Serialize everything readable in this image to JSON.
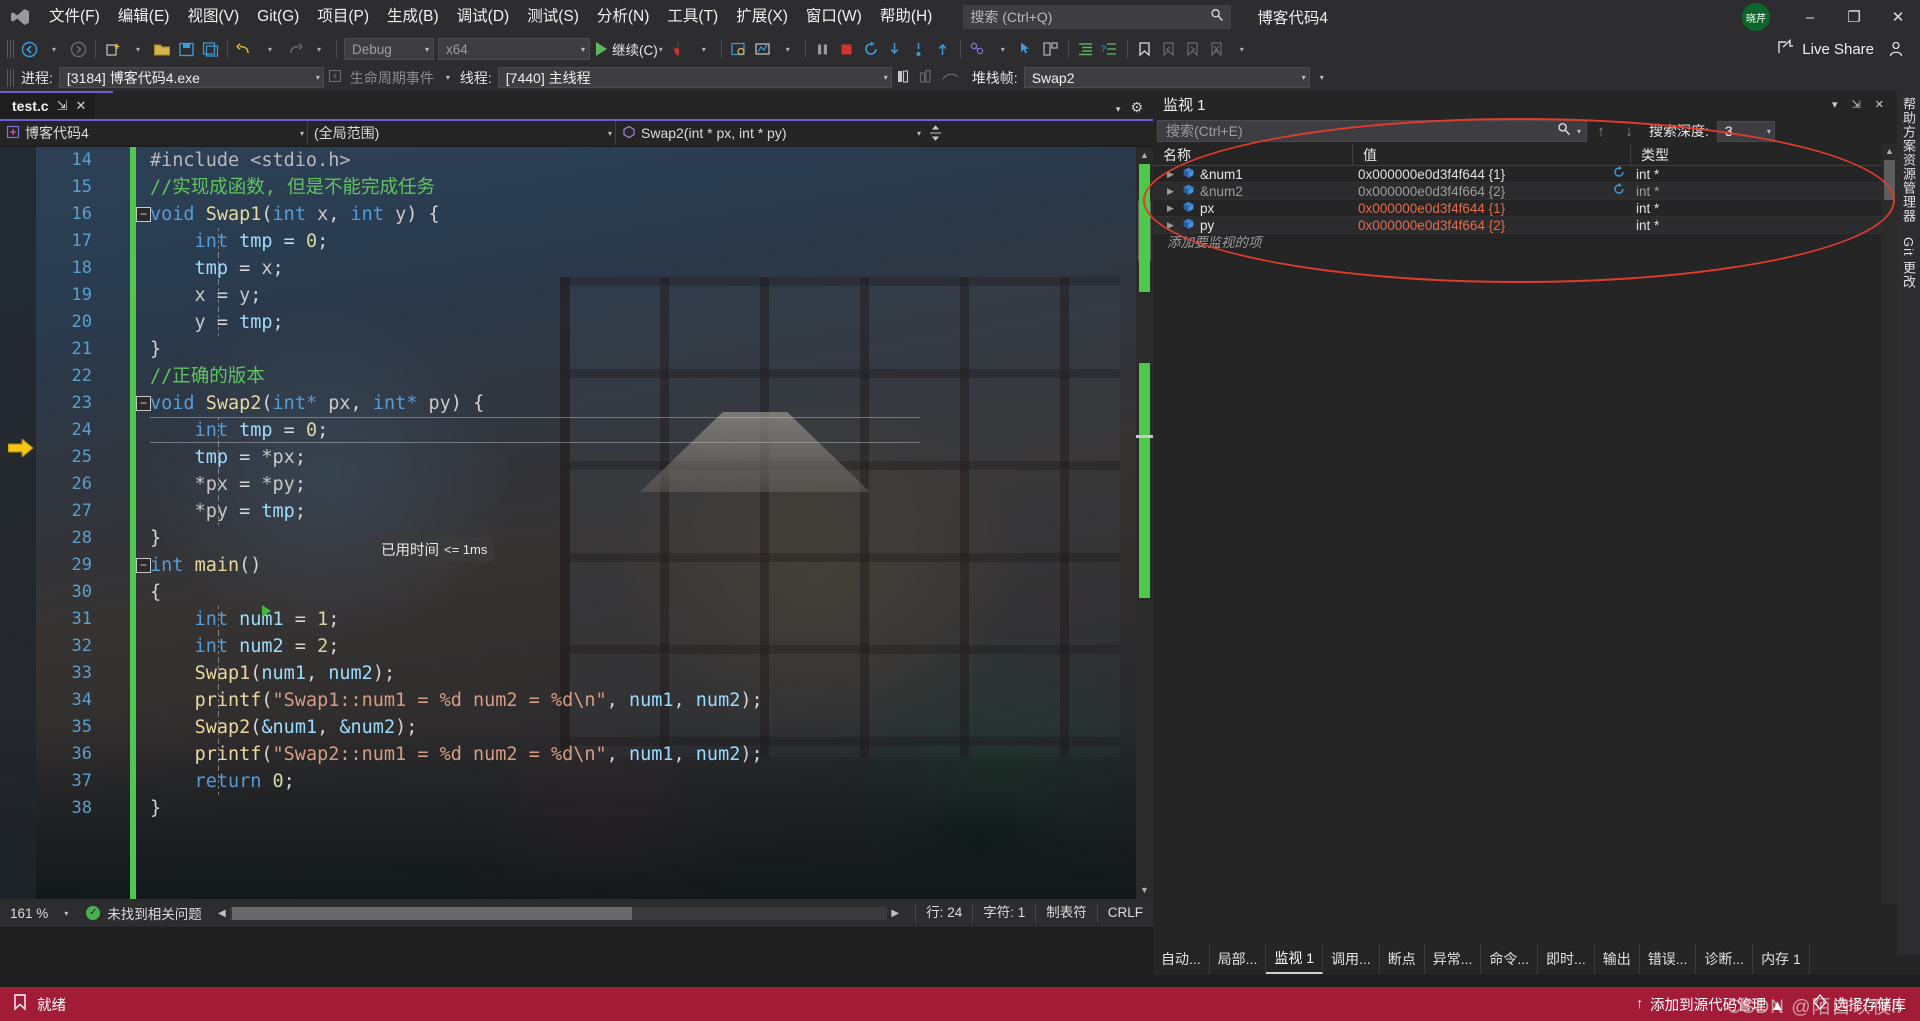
{
  "app": {
    "solution_title": "博客代码4",
    "logo_icon": "visual-studio-logo"
  },
  "menu": {
    "items": [
      {
        "label": "文件(F)"
      },
      {
        "label": "编辑(E)"
      },
      {
        "label": "视图(V)"
      },
      {
        "label": "Git(G)"
      },
      {
        "label": "项目(P)"
      },
      {
        "label": "生成(B)"
      },
      {
        "label": "调试(D)"
      },
      {
        "label": "测试(S)"
      },
      {
        "label": "分析(N)"
      },
      {
        "label": "工具(T)"
      },
      {
        "label": "扩展(X)"
      },
      {
        "label": "窗口(W)"
      },
      {
        "label": "帮助(H)"
      }
    ]
  },
  "quick_search": {
    "placeholder": "搜索 (Ctrl+Q)",
    "icon": "search-icon"
  },
  "account": {
    "initials": "晓芹"
  },
  "window_controls": {
    "minimize": "–",
    "restore": "❐",
    "close": "✕"
  },
  "toolbar": {
    "config": "Debug",
    "platform": "x64",
    "run_label": "继续(C)",
    "live_share": "Live Share"
  },
  "debug_bar": {
    "process_label": "进程:",
    "process_value": "[3184] 博客代码4.exe",
    "lifecycle_label": "生命周期事件",
    "thread_label": "线程:",
    "thread_value": "[7440] 主线程",
    "stack_label": "堆栈帧:",
    "stack_value": "Swap2"
  },
  "editor": {
    "tab_name": "test.c",
    "tab_pin": "⇲",
    "tab_close": "✕",
    "nav_project": "博客代码4",
    "nav_scope": "(全局范围)",
    "nav_member": "Swap2(int * px, int * py)",
    "datatip": {
      "label": "已用时间",
      "value": "<= 1ms"
    },
    "lines": [
      {
        "n": "14",
        "segs": [
          {
            "t": "#include <stdio.h>",
            "c": "pp"
          }
        ],
        "indent": 0
      },
      {
        "n": "15",
        "segs": [
          {
            "t": "//实现成函数, 但是不能完成任务",
            "c": "cmt"
          }
        ],
        "indent": 1
      },
      {
        "n": "16",
        "fold": "−",
        "segs": [
          {
            "t": "void ",
            "c": "kw"
          },
          {
            "t": "Swap1",
            "c": "fn"
          },
          {
            "t": "(",
            "c": "pun"
          },
          {
            "t": "int",
            "c": "kw"
          },
          {
            "t": " x",
            "c": "id"
          },
          {
            "t": ", ",
            "c": "pun"
          },
          {
            "t": "int",
            "c": "kw"
          },
          {
            "t": " y",
            "c": "id"
          },
          {
            "t": ") {",
            "c": "pun"
          }
        ],
        "indent": 1
      },
      {
        "n": "17",
        "segs": [
          {
            "t": "    int",
            "c": "kw"
          },
          {
            "t": " tmp",
            "c": "var"
          },
          {
            "t": " = ",
            "c": "pun"
          },
          {
            "t": "0",
            "c": "num"
          },
          {
            "t": ";",
            "c": "pun"
          }
        ],
        "indent": 1,
        "guide": true
      },
      {
        "n": "18",
        "segs": [
          {
            "t": "    tmp",
            "c": "var"
          },
          {
            "t": " = ",
            "c": "pun"
          },
          {
            "t": "x",
            "c": "id"
          },
          {
            "t": ";",
            "c": "pun"
          }
        ],
        "indent": 1,
        "guide": true
      },
      {
        "n": "19",
        "segs": [
          {
            "t": "    x",
            "c": "id"
          },
          {
            "t": " = ",
            "c": "pun"
          },
          {
            "t": "y",
            "c": "id"
          },
          {
            "t": ";",
            "c": "pun"
          }
        ],
        "indent": 1,
        "guide": true
      },
      {
        "n": "20",
        "segs": [
          {
            "t": "    y",
            "c": "id"
          },
          {
            "t": " = ",
            "c": "pun"
          },
          {
            "t": "tmp",
            "c": "var"
          },
          {
            "t": ";",
            "c": "pun"
          }
        ],
        "indent": 1,
        "guide": true
      },
      {
        "n": "21",
        "segs": [
          {
            "t": "}",
            "c": "pun"
          }
        ],
        "indent": 1
      },
      {
        "n": "22",
        "segs": [
          {
            "t": "//正确的版本",
            "c": "cmt"
          }
        ],
        "indent": 1
      },
      {
        "n": "23",
        "fold": "−",
        "segs": [
          {
            "t": "void ",
            "c": "kw"
          },
          {
            "t": "Swap2",
            "c": "fn"
          },
          {
            "t": "(",
            "c": "pun"
          },
          {
            "t": "int*",
            "c": "kw"
          },
          {
            "t": " px",
            "c": "id"
          },
          {
            "t": ", ",
            "c": "pun"
          },
          {
            "t": "int*",
            "c": "kw"
          },
          {
            "t": " py",
            "c": "id"
          },
          {
            "t": ") {",
            "c": "pun"
          }
        ],
        "indent": 1
      },
      {
        "n": "24",
        "segs": [
          {
            "t": "    int",
            "c": "kw"
          },
          {
            "t": " tmp",
            "c": "var"
          },
          {
            "t": " = ",
            "c": "pun"
          },
          {
            "t": "0",
            "c": "num"
          },
          {
            "t": ";",
            "c": "pun"
          }
        ],
        "indent": 1,
        "guide": true,
        "current": true
      },
      {
        "n": "25",
        "segs": [
          {
            "t": "    tmp",
            "c": "var"
          },
          {
            "t": " = ",
            "c": "pun"
          },
          {
            "t": "*px",
            "c": "id"
          },
          {
            "t": ";",
            "c": "pun"
          }
        ],
        "indent": 1,
        "guide": true
      },
      {
        "n": "26",
        "segs": [
          {
            "t": "    *px",
            "c": "id"
          },
          {
            "t": " = ",
            "c": "pun"
          },
          {
            "t": "*py",
            "c": "id"
          },
          {
            "t": ";",
            "c": "pun"
          }
        ],
        "indent": 1,
        "guide": true,
        "bp": true
      },
      {
        "n": "27",
        "segs": [
          {
            "t": "    *py",
            "c": "id"
          },
          {
            "t": " = ",
            "c": "pun"
          },
          {
            "t": "tmp",
            "c": "var"
          },
          {
            "t": ";",
            "c": "pun"
          }
        ],
        "indent": 1,
        "guide": true
      },
      {
        "n": "28",
        "segs": [
          {
            "t": "}",
            "c": "pun"
          }
        ],
        "indent": 1
      },
      {
        "n": "29",
        "fold": "−",
        "segs": [
          {
            "t": "int ",
            "c": "kw"
          },
          {
            "t": "main",
            "c": "fn"
          },
          {
            "t": "()",
            "c": "pun"
          }
        ],
        "indent": 1
      },
      {
        "n": "30",
        "segs": [
          {
            "t": "{",
            "c": "pun"
          }
        ],
        "indent": 1
      },
      {
        "n": "31",
        "segs": [
          {
            "t": "    int",
            "c": "kw"
          },
          {
            "t": " num1",
            "c": "var"
          },
          {
            "t": " = ",
            "c": "pun"
          },
          {
            "t": "1",
            "c": "num"
          },
          {
            "t": ";",
            "c": "pun"
          }
        ],
        "indent": 1,
        "guide": true
      },
      {
        "n": "32",
        "segs": [
          {
            "t": "    int",
            "c": "kw"
          },
          {
            "t": " num2",
            "c": "var"
          },
          {
            "t": " = ",
            "c": "pun"
          },
          {
            "t": "2",
            "c": "num"
          },
          {
            "t": ";",
            "c": "pun"
          }
        ],
        "indent": 1,
        "guide": true
      },
      {
        "n": "33",
        "segs": [
          {
            "t": "    ",
            "c": "pun"
          },
          {
            "t": "Swap1",
            "c": "fn"
          },
          {
            "t": "(",
            "c": "pun"
          },
          {
            "t": "num1",
            "c": "var"
          },
          {
            "t": ", ",
            "c": "pun"
          },
          {
            "t": "num2",
            "c": "var"
          },
          {
            "t": ");",
            "c": "pun"
          }
        ],
        "indent": 1,
        "guide": true
      },
      {
        "n": "34",
        "segs": [
          {
            "t": "    ",
            "c": "pun"
          },
          {
            "t": "printf",
            "c": "fn"
          },
          {
            "t": "(",
            "c": "pun"
          },
          {
            "t": "\"Swap1::num1 = %d num2 = %d\\n\"",
            "c": "str"
          },
          {
            "t": ", ",
            "c": "pun"
          },
          {
            "t": "num1",
            "c": "var"
          },
          {
            "t": ", ",
            "c": "pun"
          },
          {
            "t": "num2",
            "c": "var"
          },
          {
            "t": ");",
            "c": "pun"
          }
        ],
        "indent": 1,
        "guide": true
      },
      {
        "n": "35",
        "segs": [
          {
            "t": "    ",
            "c": "pun"
          },
          {
            "t": "Swap2",
            "c": "fn"
          },
          {
            "t": "(",
            "c": "pun"
          },
          {
            "t": "&num1",
            "c": "var"
          },
          {
            "t": ", ",
            "c": "pun"
          },
          {
            "t": "&num2",
            "c": "var"
          },
          {
            "t": ");",
            "c": "pun"
          }
        ],
        "indent": 1,
        "guide": true
      },
      {
        "n": "36",
        "segs": [
          {
            "t": "    ",
            "c": "pun"
          },
          {
            "t": "printf",
            "c": "fn"
          },
          {
            "t": "(",
            "c": "pun"
          },
          {
            "t": "\"Swap2::num1 = %d num2 = %d\\n\"",
            "c": "str"
          },
          {
            "t": ", ",
            "c": "pun"
          },
          {
            "t": "num1",
            "c": "var"
          },
          {
            "t": ", ",
            "c": "pun"
          },
          {
            "t": "num2",
            "c": "var"
          },
          {
            "t": ");",
            "c": "pun"
          }
        ],
        "indent": 1,
        "guide": true
      },
      {
        "n": "37",
        "segs": [
          {
            "t": "    return ",
            "c": "kw"
          },
          {
            "t": "0",
            "c": "num"
          },
          {
            "t": ";",
            "c": "pun"
          }
        ],
        "indent": 1,
        "guide": true
      },
      {
        "n": "38",
        "segs": [
          {
            "t": "}",
            "c": "pun"
          }
        ],
        "indent": 1
      }
    ],
    "status": {
      "zoom": "161 %",
      "issues": "未找到相关问题",
      "line": "行: 24",
      "column": "字符: 1",
      "tabs_mode": "制表符",
      "eol": "CRLF"
    }
  },
  "watch": {
    "title": "监视 1",
    "search_placeholder": "搜索(Ctrl+E)",
    "depth_label": "搜索深度:",
    "depth_value": "3",
    "columns": [
      "名称",
      "值",
      "类型"
    ],
    "rows": [
      {
        "name": "&num1",
        "value": "0x000000e0d3f4f644 {1}",
        "type": "int *",
        "name_style": "nm-white",
        "value_style": "vl-white",
        "type_style": "ty-white",
        "refresh": true
      },
      {
        "name": "&num2",
        "value": "0x000000e0d3f4f664 {2}",
        "type": "int *",
        "name_style": "nm-gray",
        "value_style": "vl-gray",
        "type_style": "ty-gray",
        "refresh": true
      },
      {
        "name": "px",
        "value": "0x000000e0d3f4f644 {1}",
        "type": "int *",
        "name_style": "nm-white",
        "value_style": "vl-red",
        "type_style": "ty-white",
        "refresh": false
      },
      {
        "name": "py",
        "value": "0x000000e0d3f4f664 {2}",
        "type": "int *",
        "name_style": "nm-white",
        "value_style": "vl-red",
        "type_style": "ty-white",
        "refresh": false
      }
    ],
    "add_row_placeholder": "添加要监视的项"
  },
  "bottom_tabs": [
    {
      "label": "自动...",
      "active": false
    },
    {
      "label": "局部...",
      "active": false
    },
    {
      "label": "监视 1",
      "active": true
    },
    {
      "label": "调用...",
      "active": false
    },
    {
      "label": "断点",
      "active": false
    },
    {
      "label": "异常...",
      "active": false
    },
    {
      "label": "命令...",
      "active": false
    },
    {
      "label": "即时...",
      "active": false
    },
    {
      "label": "输出",
      "active": false
    },
    {
      "label": "错误...",
      "active": false
    },
    {
      "label": "诊断...",
      "active": false
    },
    {
      "label": "内存 1",
      "active": false
    }
  ],
  "right_strip": {
    "top_label": "帮助方案资源管理器",
    "bottom_label": "Git 更改"
  },
  "statusbar": {
    "state": "就绪",
    "source_control": "添加到源代码管理 ▲",
    "repo": "选择存储库"
  },
  "watermark": "CSDN @陌白以夜ll",
  "colors": {
    "status_bar": "#a31c37",
    "accent_purple": "#6d5fd5",
    "change_bar_green": "#4ec94e",
    "annotation_red": "#e03c2e"
  }
}
